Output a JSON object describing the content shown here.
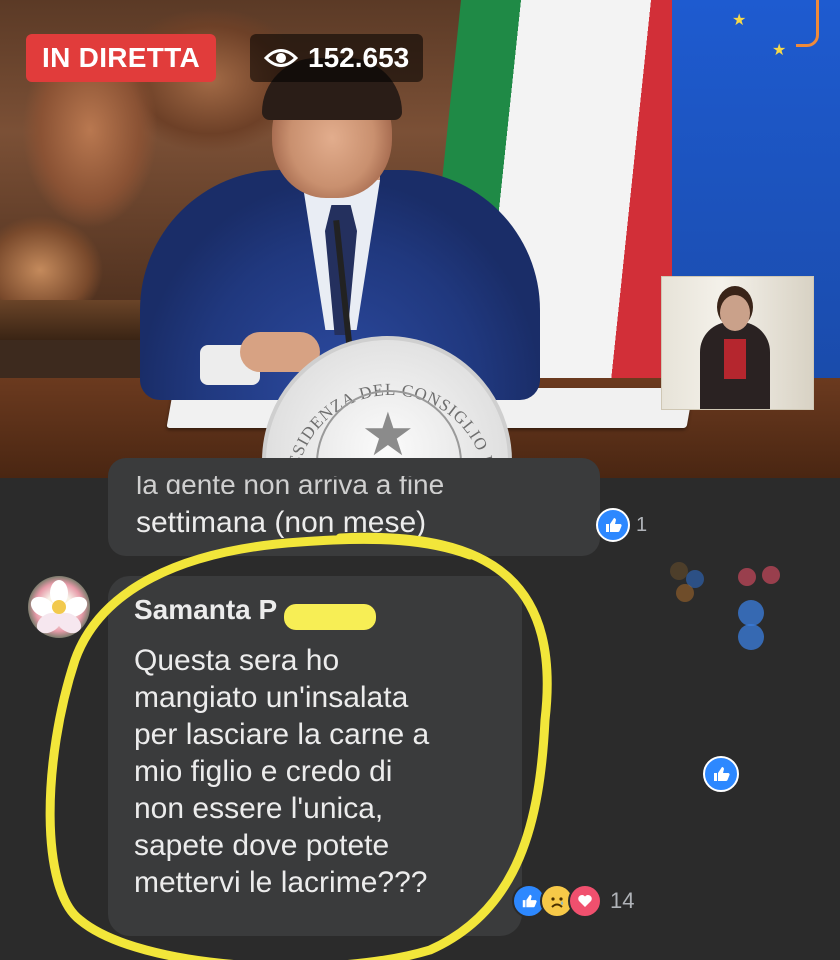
{
  "live": {
    "badge": "IN DIRETTA",
    "viewers": "152.653"
  },
  "seal_text": "PRESIDENZA DEL CONSIGLIO DEI MINISTRI",
  "previous_comment": {
    "cut_line": "la gente non arriva a fine",
    "text": "settimana (non mese)",
    "like_count": "1"
  },
  "main_comment": {
    "author": "Samanta P",
    "lines": [
      "Questa sera ho",
      "mangiato un'insalata",
      "per lasciare la carne a",
      "mio figlio e credo di",
      "non essere l'unica,",
      "sapete dove potete",
      "mettervi le lacrime???"
    ],
    "reaction_count": "14"
  },
  "icons": {
    "viewers": "eye-icon",
    "like": "thumbs-up-icon",
    "sad": "sad-face-icon",
    "love": "heart-icon"
  },
  "colors": {
    "live_red": "#e13c3b",
    "like_blue": "#2d88ff",
    "highlight_yellow": "#f7ee55",
    "bubble": "#3a3b3c"
  }
}
